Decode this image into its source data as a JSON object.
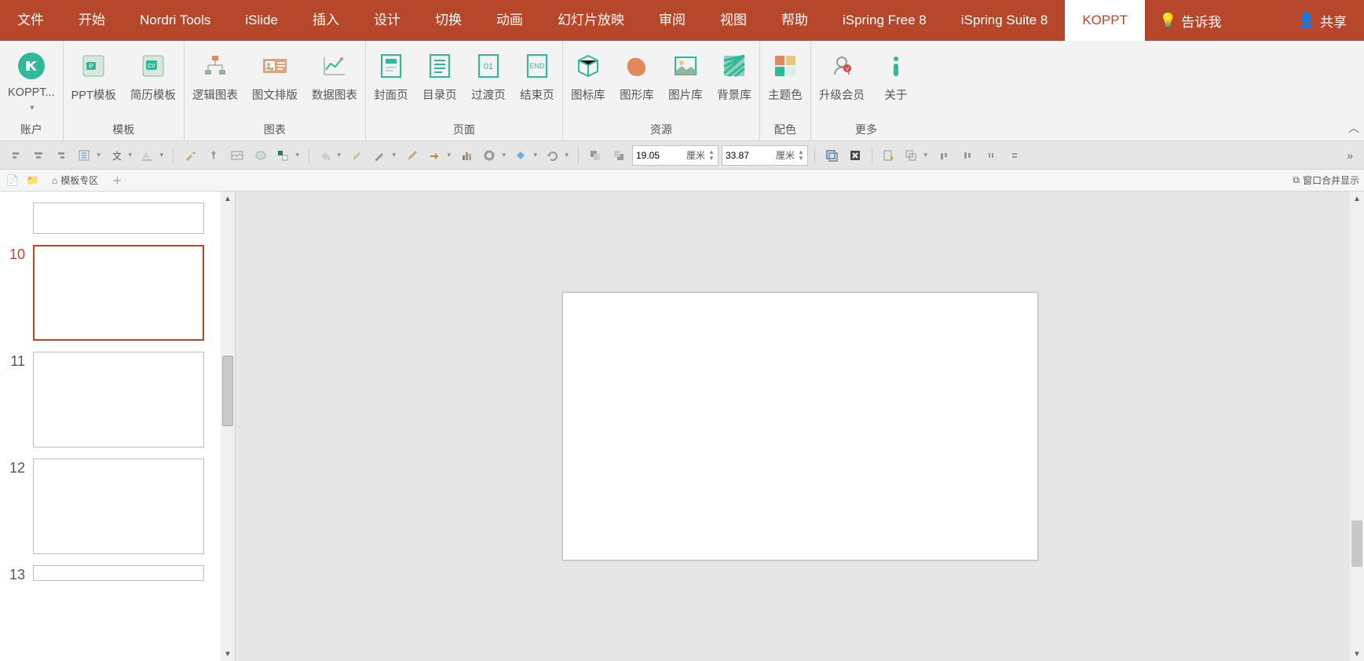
{
  "tabs": {
    "file": "文件",
    "home": "开始",
    "nordri": "Nordri Tools",
    "islide": "iSlide",
    "insert": "插入",
    "design": "设计",
    "transition": "切换",
    "animation": "动画",
    "slideshow": "幻灯片放映",
    "review": "审阅",
    "view": "视图",
    "help": "帮助",
    "ispringfree": "iSpring Free 8",
    "ispringsuite": "iSpring Suite 8",
    "koppt": "KOPPT",
    "tell_me": "告诉我",
    "share": "共享"
  },
  "ribbon": {
    "account": {
      "koppt": "KOPPT...",
      "label": "账户"
    },
    "templates": {
      "ppt": "PPT模板",
      "resume": "简历模板",
      "label": "模板"
    },
    "charts": {
      "logic": "逻辑图表",
      "imgtxt": "图文排版",
      "data": "数据图表",
      "label": "图表"
    },
    "pages": {
      "cover": "封面页",
      "toc": "目录页",
      "transition": "过渡页",
      "end": "结束页",
      "label": "页面"
    },
    "resources": {
      "icons": "图标库",
      "shapes": "图形库",
      "images": "图片库",
      "backgrounds": "背景库",
      "label": "资源"
    },
    "color": {
      "theme": "主题色",
      "label": "配色"
    },
    "more": {
      "upgrade": "升级会员",
      "about": "关于",
      "label": "更多"
    }
  },
  "toolbar2": {
    "height_value": "19.05",
    "height_unit": "厘米",
    "width_value": "33.87",
    "width_unit": "厘米"
  },
  "doc_tabs": {
    "template_area": "模板专区",
    "window_merge": "窗口合并显示"
  },
  "slides": {
    "s10": "10",
    "s11": "11",
    "s12": "12",
    "s13": "13"
  }
}
